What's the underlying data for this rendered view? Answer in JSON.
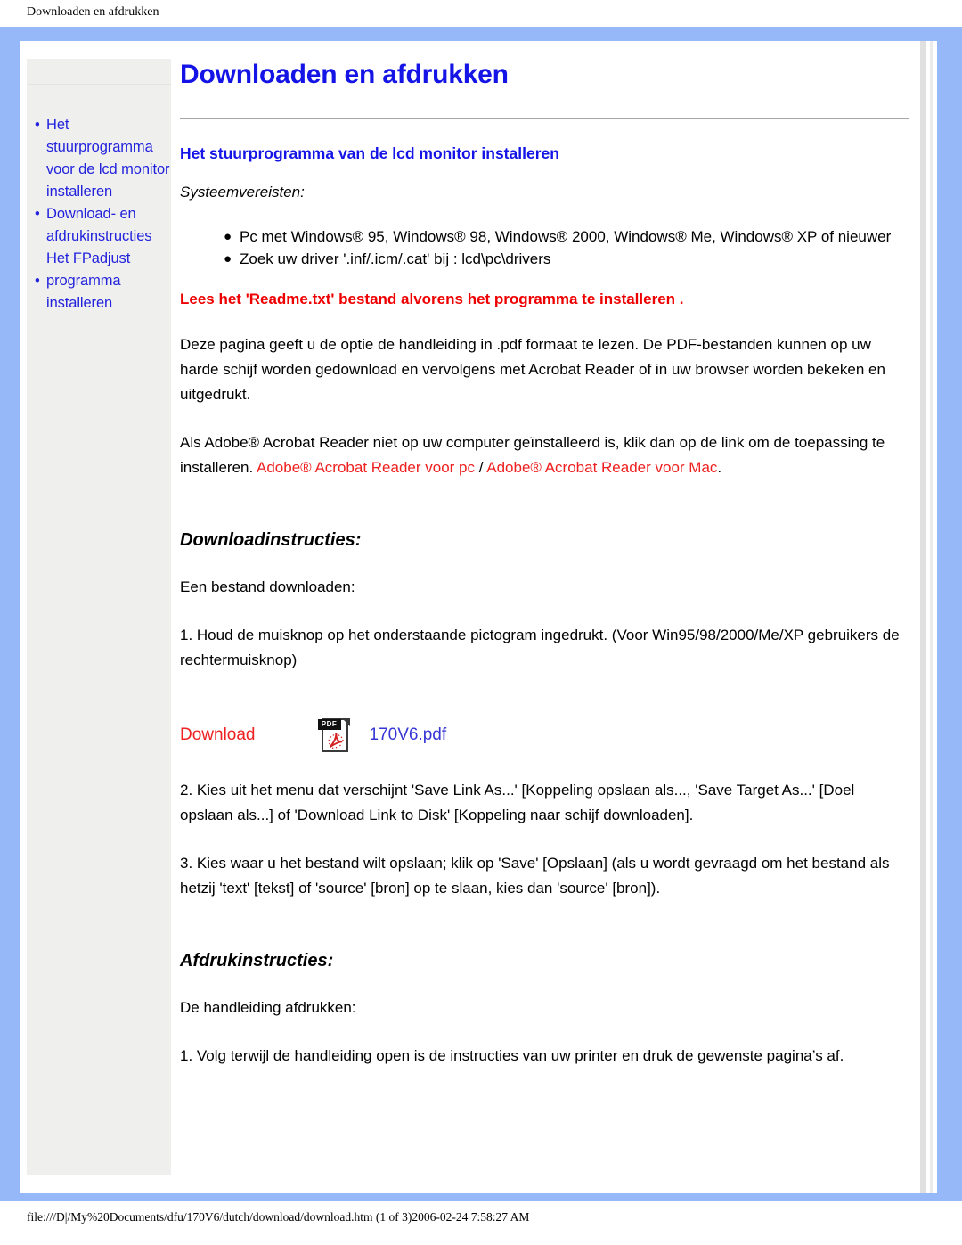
{
  "page_header": {
    "title": "Downloaden en afdrukken"
  },
  "sidebar": {
    "items": [
      {
        "bullet": "•",
        "label": "Het stuurprogramma voor de lcd monitor installeren"
      },
      {
        "bullet": "•",
        "label": "Download- en afdrukinstructies Het FPadjust"
      },
      {
        "bullet": "•",
        "label": "programma installeren"
      }
    ]
  },
  "content": {
    "title": "Downloaden en afdrukken",
    "section_driver": {
      "heading": "Het stuurprogramma van de lcd monitor installeren",
      "requirements_label": "Systeemvereisten:",
      "requirements": [
        "Pc met Windows® 95, Windows® 98, Windows® 2000, Windows® Me, Windows® XP of nieuwer",
        "Zoek uw driver '.inf/.icm/.cat' bij : lcd\\pc\\drivers"
      ],
      "warning": "Lees het 'Readme.txt' bestand alvorens het programma te installeren ."
    },
    "paragraph_pdf": "Deze pagina geeft u de optie de handleiding in .pdf formaat te lezen. De PDF-bestanden kunnen op uw harde schijf worden gedownload en vervolgens met Acrobat Reader of in uw browser worden bekeken en uitgedrukt.",
    "paragraph_acrobat": {
      "lead": "Als Adobe® Acrobat Reader niet op uw computer geïnstalleerd is, klik dan op de link om de toepassing te installeren. ",
      "link_pc": "Adobe® Acrobat Reader voor pc",
      "separator": " / ",
      "link_mac": "Adobe® Acrobat Reader voor Mac",
      "tail": "."
    },
    "section_download": {
      "heading": "Downloadinstructies:",
      "intro": "Een bestand downloaden:",
      "step1": "1. Houd de muisknop op het onderstaande pictogram ingedrukt. (Voor Win95/98/2000/Me/XP gebruikers de rechtermuisknop)",
      "download_label": "Download",
      "pdf_icon_label": "PDF",
      "pdf_file_name": "170V6.pdf",
      "step2": "2. Kies uit het menu dat verschijnt 'Save Link As...' [Koppeling opslaan als..., 'Save Target As...' [Doel opslaan als...] of 'Download Link to Disk' [Koppeling naar schijf downloaden].",
      "step3": "3. Kies waar u het bestand wilt opslaan; klik op 'Save' [Opslaan] (als u wordt gevraagd om het bestand als hetzij 'text' [tekst] of 'source' [bron] op te slaan, kies dan 'source' [bron])."
    },
    "section_print": {
      "heading": "Afdrukinstructies:",
      "intro": "De handleiding afdrukken:",
      "step1": "1. Volg terwijl de handleiding open is de instructies van uw printer en druk de gewenste pagina’s af."
    }
  },
  "footer": {
    "path": "file:///D|/My%20Documents/dfu/170V6/dutch/download/download.htm (1 of 3)2006-02-24 7:58:27 AM"
  },
  "colors": {
    "frame_blue": "#96b7f8",
    "link_blue": "#2222dd",
    "heading_blue": "#1414e6",
    "warning_red": "#ef0000",
    "link_red": "#ef2020",
    "sidebar_gray": "#efefee"
  }
}
